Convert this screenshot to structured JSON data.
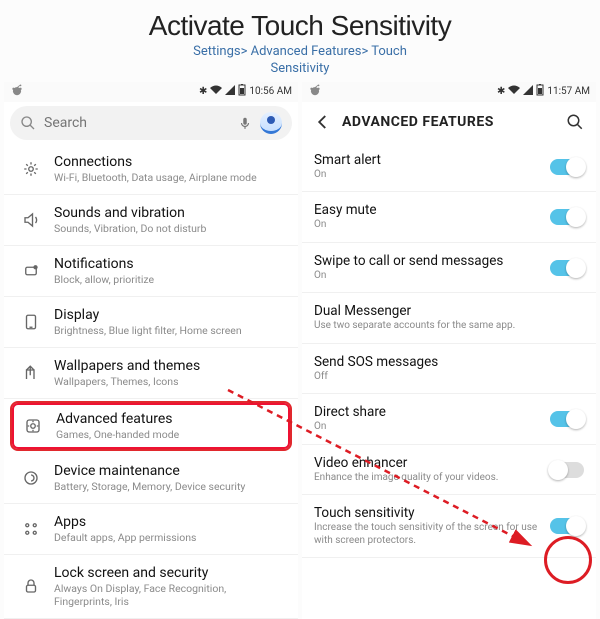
{
  "title": "Activate Touch Sensitivity",
  "breadcrumb_line1": "Settings> Advanced Features> Touch",
  "breadcrumb_line2": "Sensitivity",
  "left": {
    "status_time": "10:56 AM",
    "search_placeholder": "Search",
    "items": [
      {
        "icon": "connections",
        "label": "Connections",
        "sub": "Wi-Fi, Bluetooth, Data usage, Airplane mode"
      },
      {
        "icon": "sound",
        "label": "Sounds and vibration",
        "sub": "Sounds, Vibration, Do not disturb"
      },
      {
        "icon": "notifications",
        "label": "Notifications",
        "sub": "Block, allow, prioritize"
      },
      {
        "icon": "display",
        "label": "Display",
        "sub": "Brightness, Blue light filter, Home screen"
      },
      {
        "icon": "wallpaper",
        "label": "Wallpapers and themes",
        "sub": "Wallpapers, Themes, Icons"
      },
      {
        "icon": "advanced",
        "label": "Advanced features",
        "sub": "Games, One-handed mode",
        "highlighted": true
      },
      {
        "icon": "maintenance",
        "label": "Device maintenance",
        "sub": "Battery, Storage, Memory, Device security"
      },
      {
        "icon": "apps",
        "label": "Apps",
        "sub": "Default apps, App permissions"
      },
      {
        "icon": "lock",
        "label": "Lock screen and security",
        "sub": "Always On Display, Face Recognition, Fingerprints, Iris"
      }
    ]
  },
  "right": {
    "status_time": "11:57 AM",
    "header": "ADVANCED FEATURES",
    "rows": [
      {
        "label": "Smart alert",
        "sub": "On",
        "toggle": "on"
      },
      {
        "label": "Easy mute",
        "sub": "On",
        "toggle": "on"
      },
      {
        "label": "Swipe to call or send messages",
        "sub": "On",
        "toggle": "on"
      },
      {
        "label": "Dual Messenger",
        "sub": "Use two separate accounts for the same app.",
        "toggle": null
      },
      {
        "label": "Send SOS messages",
        "sub": "Off",
        "toggle": null
      },
      {
        "label": "Direct share",
        "sub": "On",
        "toggle": "on"
      },
      {
        "label": "Video enhancer",
        "sub": "Enhance the image quality of your videos.",
        "toggle": "off"
      },
      {
        "label": "Touch sensitivity",
        "sub": "Increase the touch sensitivity of the screen for use with screen protectors.",
        "toggle": "on",
        "circled": true
      }
    ]
  }
}
